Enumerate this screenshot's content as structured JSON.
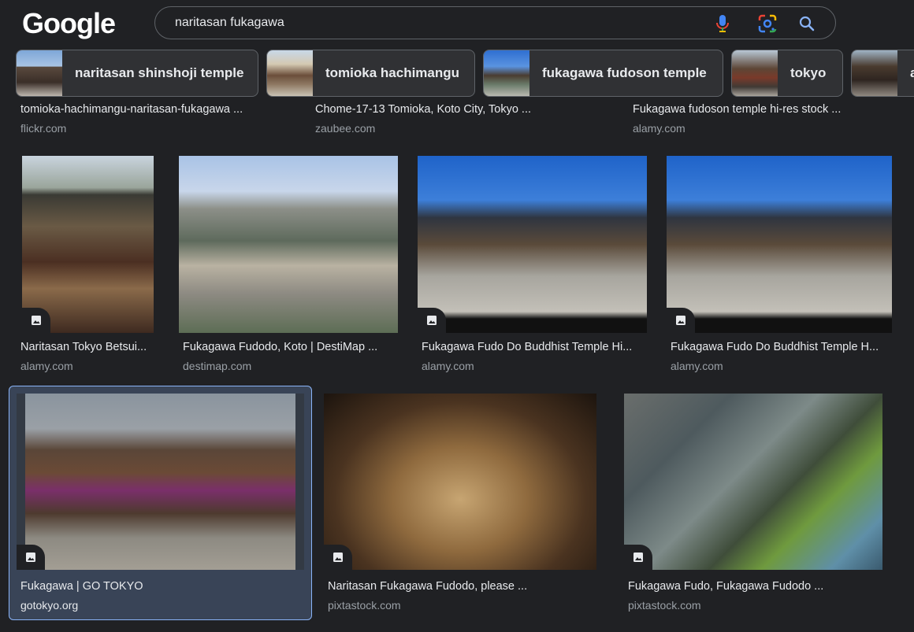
{
  "search": {
    "query": "naritasan fukagawa"
  },
  "logo": {
    "text": "Google"
  },
  "icons": {
    "mic": "microphone-icon",
    "lens": "google-lens-icon",
    "search": "search-icon",
    "image_badge": "image-icon"
  },
  "chips": [
    {
      "label": "naritasan shinshoji temple"
    },
    {
      "label": "tomioka hachimangu"
    },
    {
      "label": "fukagawa fudoson temple"
    },
    {
      "label": "tokyo"
    },
    {
      "label": "a"
    }
  ],
  "results_top_partial": [
    {
      "title": "tomioka-hachimangu-naritasan-fukagawa ...",
      "source": "flickr.com"
    },
    {
      "title": "Chome-17-13 Tomioka, Koto City, Tokyo ...",
      "source": "zaubee.com"
    },
    {
      "title": "Fukagawa fudoson temple hi-res stock ...",
      "source": "alamy.com"
    }
  ],
  "results_row1": [
    {
      "title": "Naritasan Tokyo Betsui...",
      "source": "alamy.com"
    },
    {
      "title": "Fukagawa Fudodo, Koto | DestiMap ...",
      "source": "destimap.com"
    },
    {
      "title": "Fukagawa Fudo Do Buddhist Temple Hi...",
      "source": "alamy.com"
    },
    {
      "title": "Fukagawa Fudo Do Buddhist Temple H...",
      "source": "alamy.com"
    }
  ],
  "results_row2": [
    {
      "title": "Fukagawa | GO TOKYO",
      "source": "gotokyo.org"
    },
    {
      "title": "Naritasan Fukagawa Fudodo, please ...",
      "source": "pixtastock.com"
    },
    {
      "title": "Fukagawa Fudo, Fukagawa Fudodo ...",
      "source": "pixtastock.com"
    }
  ],
  "colors": {
    "background": "#202124",
    "selected": "#394457",
    "selected_border": "#8ab4f8",
    "source_text": "#9aa0a6"
  }
}
